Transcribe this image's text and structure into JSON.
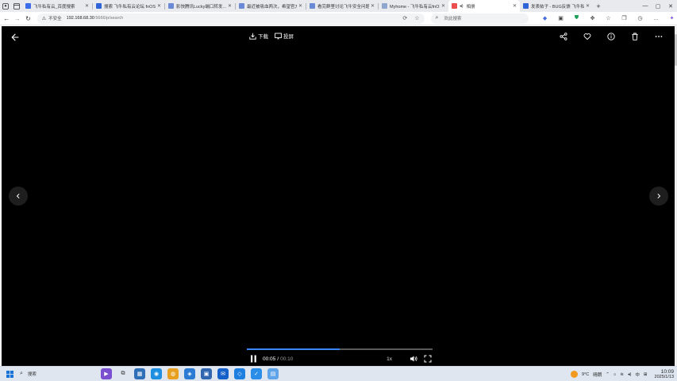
{
  "browser": {
    "tabs": [
      {
        "title": "飞牛私有云_百度搜索",
        "favicon_color": "#3b6ee8",
        "active": false
      },
      {
        "title": "搜索 飞牛私有云论坛 fnOS",
        "favicon_color": "#2f64d8",
        "active": false
      },
      {
        "title": "影快腾讯Lucky端口转发...",
        "favicon_color": "#6a8ad6",
        "active": false
      },
      {
        "title": "最近被吸血两次，希望官方...",
        "favicon_color": "#6a8ad6",
        "active": false
      },
      {
        "title": "看完群里讨论飞牛安全问题...",
        "favicon_color": "#6a8ad6",
        "active": false
      },
      {
        "title": "Myhome - 飞牛私有云fnOS",
        "favicon_color": "#8fa6cf",
        "active": false
      },
      {
        "title": "相册",
        "favicon_color": "#e94f4f",
        "active": true,
        "audio_icon": "speaker-icon"
      },
      {
        "title": "发表帖子 - BUG反馈 飞牛私有云",
        "favicon_color": "#2f64d8",
        "active": false
      }
    ],
    "new_tab_label": "+",
    "window_controls": {
      "minimize": "—",
      "maximize": "▢",
      "close": "✕"
    },
    "address": {
      "security_label": "不安全",
      "url_host": "192.168.68.30",
      "url_path": ":5666/p/search"
    },
    "search_placeholder": "欢此搜索"
  },
  "viewer": {
    "download_label": "下载",
    "cast_label": "投屏",
    "time_current": "00:05",
    "time_separator": "/",
    "time_total": "00:10",
    "playback_speed": "1x",
    "progress_fraction": 0.5,
    "accent_color": "#3a86ff"
  },
  "taskbar": {
    "search_label": "搜索",
    "weather_temp": "9°C",
    "weather_desc": "晴朗",
    "ime_label": "中",
    "time": "10:09",
    "date": "2025/1/13"
  }
}
